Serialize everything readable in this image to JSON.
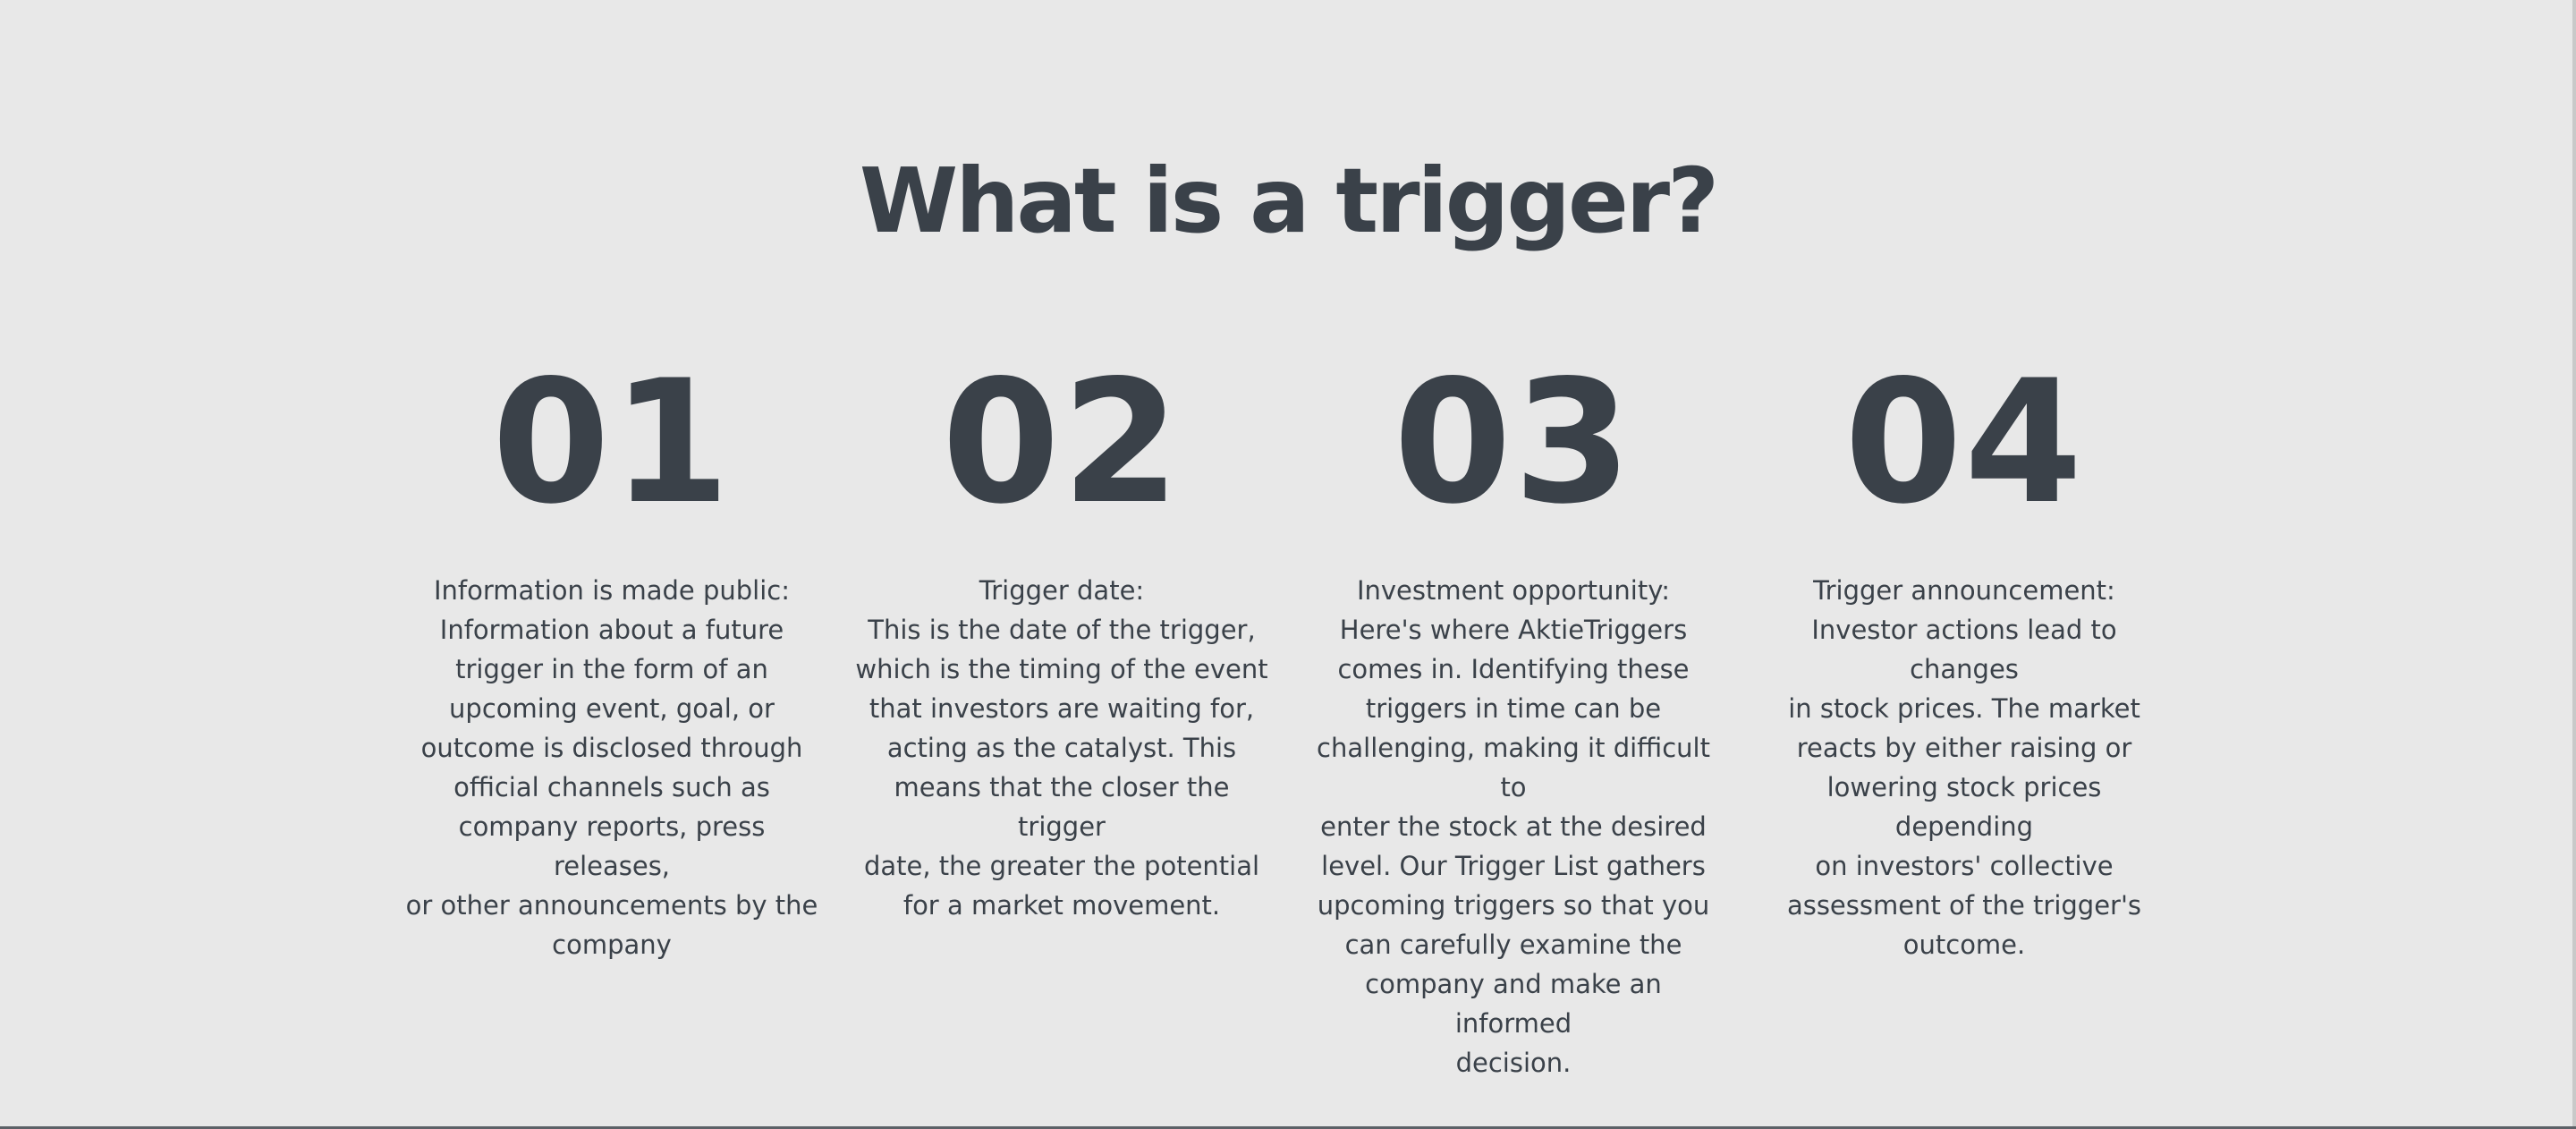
{
  "heading": "What is a trigger?",
  "steps": [
    {
      "number": "01",
      "lines": [
        "Information is made public:",
        "Information about a future",
        "trigger in the form of an",
        "upcoming event, goal, or",
        "outcome is disclosed through",
        "official channels such as",
        "company reports, press releases,",
        "or other announcements by the",
        "company"
      ]
    },
    {
      "number": "02",
      "lines": [
        "Trigger date:",
        "This is the date of the trigger,",
        "which is the timing of the event",
        "that investors are waiting for,",
        "acting as the catalyst. This",
        "means that the closer the trigger",
        "date, the greater the potential",
        "for a market movement."
      ]
    },
    {
      "number": "03",
      "lines": [
        "Investment opportunity:",
        "Here's where AktieTriggers",
        "comes in. Identifying these",
        "triggers in time can be",
        "challenging, making it difficult to",
        "enter the stock at the desired",
        "level. Our Trigger List gathers",
        "upcoming triggers so that you",
        "can carefully examine the",
        "company and make an informed",
        "decision."
      ]
    },
    {
      "number": "04",
      "lines": [
        "Trigger announcement:",
        "Investor actions lead to changes",
        "in stock prices. The market",
        "reacts by either raising or",
        "lowering stock prices depending",
        "on investors' collective",
        "assessment of the trigger's",
        "outcome."
      ]
    }
  ]
}
